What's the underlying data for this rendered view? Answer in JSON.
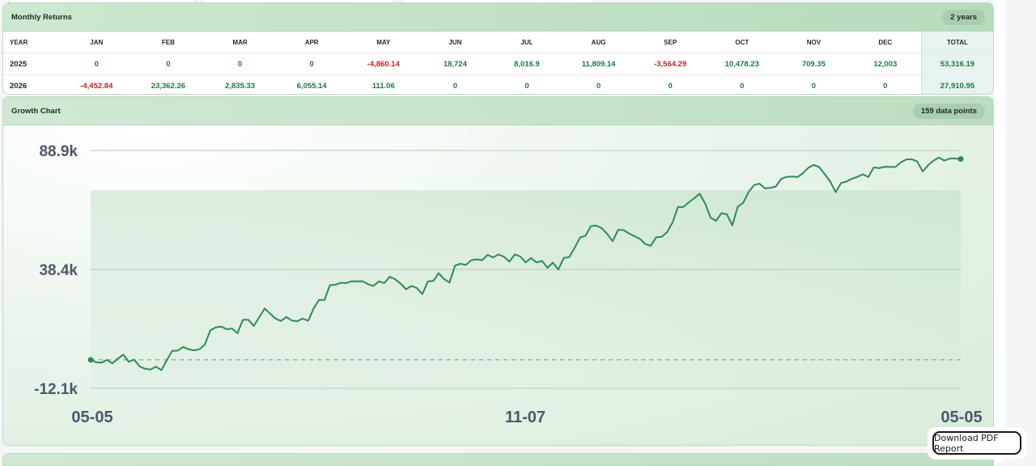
{
  "returns": {
    "title": "Monthly Returns",
    "badge": "2 years",
    "headers": [
      "YEAR",
      "JAN",
      "FEB",
      "MAR",
      "APR",
      "MAY",
      "JUN",
      "JUL",
      "AUG",
      "SEP",
      "OCT",
      "NOV",
      "DEC",
      "TOTAL"
    ],
    "rows": [
      {
        "year": "2025",
        "values": [
          "0",
          "0",
          "0",
          "0",
          "-4,860.14",
          "18,724",
          "8,016.9",
          "11,809.14",
          "-3,564.29",
          "10,478.23",
          "709.35",
          "12,003"
        ],
        "total": "53,316.19"
      },
      {
        "year": "2026",
        "values": [
          "-4,452.84",
          "23,362.26",
          "2,835.33",
          "6,055.14",
          "111.06",
          "0",
          "0",
          "0",
          "0",
          "0",
          "0",
          "0"
        ],
        "total": "27,910.95"
      }
    ]
  },
  "growth": {
    "title": "Growth Chart",
    "badge": "159 data points"
  },
  "chart_data": {
    "type": "line",
    "ytick_labels": [
      "88.9k",
      "38.4k",
      "-12.1k"
    ],
    "yticks": [
      88900,
      38400,
      -12100
    ],
    "ylim": [
      -12100,
      88900
    ],
    "xtick_labels": [
      "05-05",
      "11-07",
      "05-05"
    ],
    "baseline": 0,
    "grid": true,
    "series": [
      {
        "color": "#2e8b57",
        "values": [
          0,
          -1000,
          -1200,
          0,
          -1500,
          500,
          2200,
          -800,
          100,
          -2800,
          -3800,
          -4100,
          -2900,
          -4400,
          -100,
          3800,
          3900,
          5500,
          4500,
          4000,
          4500,
          6500,
          12500,
          13800,
          14100,
          13000,
          13300,
          11300,
          17000,
          17000,
          14400,
          18100,
          21800,
          19600,
          17500,
          16500,
          18200,
          16700,
          16400,
          17500,
          16600,
          21800,
          25500,
          25400,
          31700,
          31900,
          32700,
          32600,
          33400,
          33300,
          33400,
          32100,
          31400,
          33300,
          32600,
          35300,
          34200,
          32400,
          30000,
          31400,
          30500,
          27900,
          33300,
          33500,
          36800,
          34300,
          32800,
          40000,
          40800,
          40300,
          42300,
          42700,
          42300,
          44600,
          43500,
          44800,
          43800,
          41700,
          44800,
          43900,
          41400,
          43200,
          41400,
          42000,
          39100,
          41300,
          38300,
          43300,
          43600,
          47600,
          51900,
          52700,
          56800,
          57000,
          55900,
          53400,
          50400,
          55200,
          55100,
          53700,
          52500,
          51400,
          49200,
          48400,
          52100,
          52200,
          54200,
          58300,
          64900,
          64900,
          66900,
          68700,
          70500,
          66400,
          60400,
          59000,
          62300,
          61800,
          57100,
          65000,
          66700,
          71300,
          74200,
          74800,
          72800,
          73000,
          73600,
          76900,
          77700,
          77800,
          77600,
          79300,
          81600,
          82800,
          81800,
          78800,
          75700,
          71200,
          75100,
          75700,
          76900,
          77700,
          78800,
          77600,
          81700,
          81400,
          82000,
          81900,
          81900,
          83900,
          85100,
          85200,
          84200,
          80000,
          82600,
          84600,
          85900,
          84600,
          85500,
          85500,
          85300
        ]
      }
    ]
  },
  "button": {
    "label": "Download PDF Report"
  }
}
